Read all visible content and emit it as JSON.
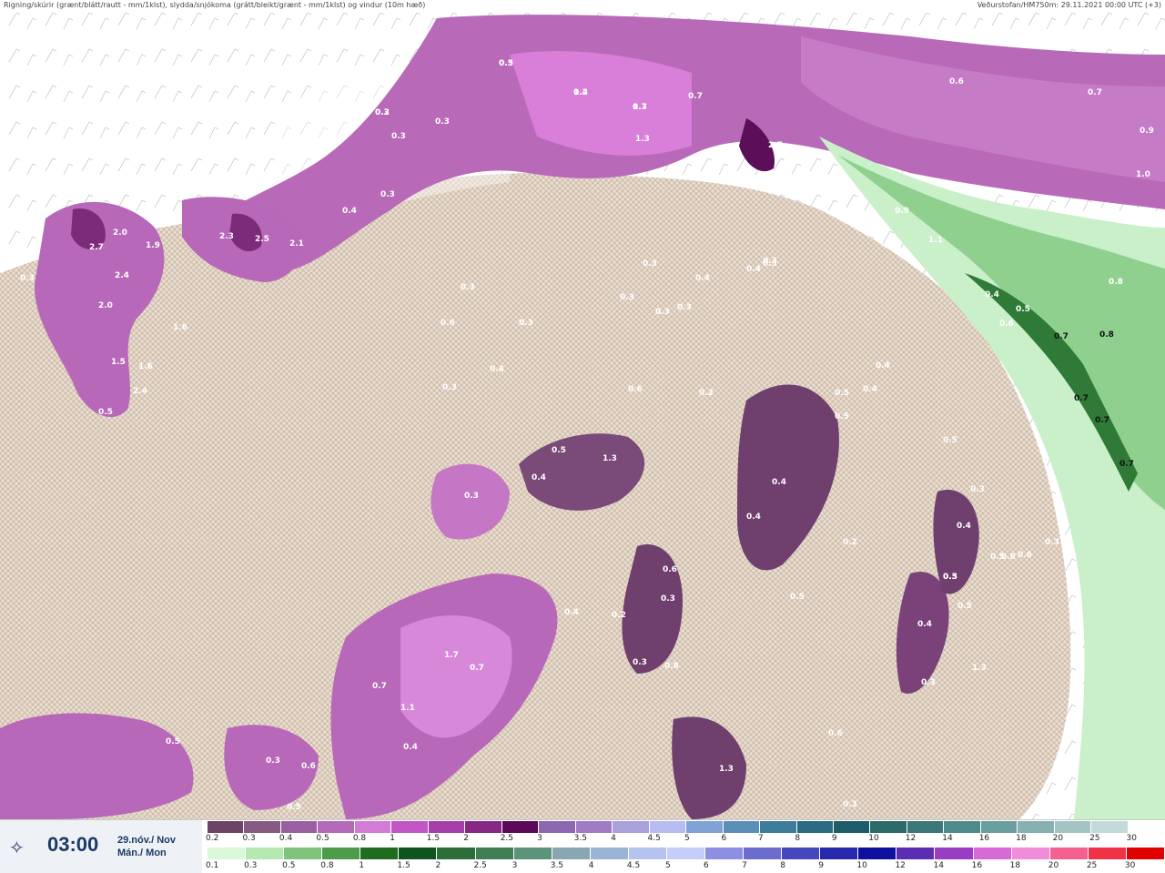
{
  "header": {
    "title": "Rigning/skúrir (grænt/blátt/rautt - mm/1klst), slydda/snjókoma (grátt/bleikt/grænt - mm/1klst) og vindur (10m hæð)",
    "source": "Veðurstofan/HM750m: 29.11.2021 00:00 UTC (+3)"
  },
  "footer": {
    "time": "03:00",
    "date_line1": "29.nóv./ Nov",
    "date_line2": "Mán./ Mon",
    "logo_icon": "compass-star-icon"
  },
  "scale_top": {
    "labels": [
      "0.2",
      "0.3",
      "0.4",
      "0.5",
      "0.8",
      "1",
      "1.5",
      "2",
      "2.5",
      "3",
      "3.5",
      "4",
      "4.5",
      "5",
      "6",
      "7",
      "8",
      "9",
      "10",
      "12",
      "14",
      "16",
      "18",
      "20",
      "25",
      "30"
    ],
    "colors": [
      "#6d4468",
      "#865a83",
      "#9a5fa0",
      "#b46ab8",
      "#d27cd6",
      "#c255c6",
      "#a63ea9",
      "#862884",
      "#5c0a58",
      "#8d67b0",
      "#9f7cc4",
      "#a9a0dc",
      "#b7bdf0",
      "#7fa3d6",
      "#5c8fb8",
      "#3f7c99",
      "#2a6b80",
      "#1f5c6a",
      "#2d6a6a",
      "#3c7878",
      "#4f8a8a",
      "#6b9e9e",
      "#87b0b0",
      "#a4c4c4",
      "#c4dada",
      "#ffffff"
    ]
  },
  "scale_bottom": {
    "labels": [
      "0.1",
      "0.3",
      "0.5",
      "0.8",
      "1",
      "1.5",
      "2",
      "2.5",
      "3",
      "3.5",
      "4",
      "4.5",
      "5",
      "6",
      "7",
      "8",
      "9",
      "10",
      "12",
      "14",
      "16",
      "18",
      "20",
      "25",
      "30"
    ],
    "colors": [
      "#d8f8d8",
      "#b6e8b2",
      "#7ec47a",
      "#4e9c4a",
      "#1f6b1f",
      "#0f5420",
      "#2b6e3a",
      "#3e7f56",
      "#5c9479",
      "#8aa6b0",
      "#9ab4d6",
      "#b4c4ee",
      "#c6cef8",
      "#8e8ee2",
      "#6c6cd0",
      "#4646be",
      "#2828ac",
      "#1010a0",
      "#5a2db4",
      "#9a3cc4",
      "#d86ad8",
      "#f08cd8",
      "#f46090",
      "#f03246",
      "#e00000"
    ]
  },
  "map": {
    "values": [
      "0.5",
      "0.3",
      "1.4",
      "1.7",
      "0.7",
      "0.6",
      "0.7",
      "0.7",
      "0.9",
      "1.0",
      "0.3",
      "1.3",
      "2.7",
      "0.3",
      "0.3",
      "0.4",
      "2.7",
      "2.0",
      "1.9",
      "2.3",
      "2.5",
      "2.1",
      "2.4",
      "1.6",
      "2.0",
      "1.5",
      "1.6",
      "2.4",
      "0.5",
      "0.3",
      "0.3",
      "0.3",
      "0.4",
      "0.3",
      "0.3",
      "0.3",
      "0.3",
      "0.3",
      "0.4",
      "0.4",
      "0.6",
      "0.6",
      "0.5",
      "1.3",
      "0.4",
      "0.3",
      "0.8",
      "0.5",
      "0.2",
      "1.0",
      "0.9",
      "1.1",
      "0.3",
      "0.4",
      "0.4",
      "0.6",
      "0.7",
      "0.8",
      "0.7",
      "0.7",
      "0.7",
      "0.5",
      "0.5",
      "0.4",
      "0.4",
      "0.3",
      "0.4",
      "0.5",
      "0.2",
      "0.3",
      "0.4",
      "0.5",
      "0.3",
      "0.6",
      "0.6",
      "0.3",
      "0.5",
      "0.4",
      "0.2",
      "0.5",
      "0.3",
      "0.4",
      "0.5",
      "0.8",
      "0.3",
      "0.6",
      "0.3",
      "1.3",
      "1.7",
      "0.7",
      "0.7",
      "1.1",
      "0.4",
      "0.5",
      "0.3",
      "0.6",
      "0.3",
      "1.3",
      "0.8",
      "0.5",
      "0.3",
      "0.2",
      "0.2",
      "0.3"
    ]
  }
}
